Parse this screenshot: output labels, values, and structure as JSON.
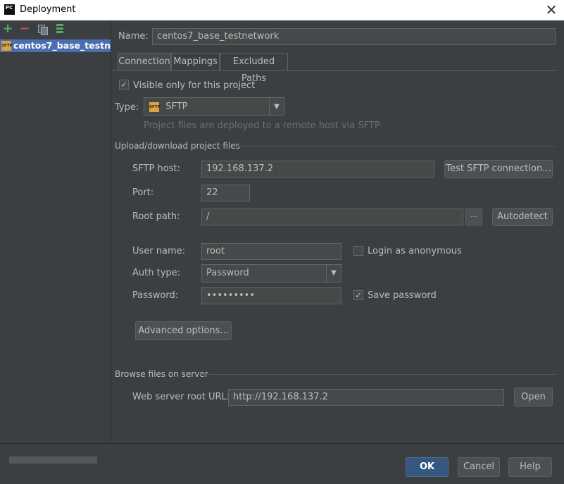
{
  "window": {
    "app_icon": "PC",
    "title": "Deployment",
    "close_icon": "close-icon"
  },
  "toolbar": {
    "add": "+",
    "remove": "−"
  },
  "servers": [
    {
      "name": "centos7_base_testnetwork",
      "icon_text": "SFTP"
    }
  ],
  "name_row": {
    "label": "Name:",
    "value": "centos7_base_testnetwork"
  },
  "tabs": [
    {
      "label": "Connection",
      "selected": true
    },
    {
      "label": "Mappings"
    },
    {
      "label": "Excluded Paths"
    }
  ],
  "connection": {
    "visible_only": {
      "label": "Visible only for this project",
      "checked": true
    },
    "type": {
      "label": "Type:",
      "value": "SFTP",
      "icon_text": "SFTP",
      "hint": "Project files are deployed to a remote host via SFTP"
    },
    "upload_section": "Upload/download project files",
    "sftp_host": {
      "label": "SFTP host:",
      "value": "192.168.137.2"
    },
    "test_button": "Test SFTP connection...",
    "port": {
      "label": "Port:",
      "value": "22"
    },
    "root_path": {
      "label": "Root path:",
      "value": "/"
    },
    "browse_button": "...",
    "autodetect_button": "Autodetect",
    "user_name": {
      "label": "User name:",
      "value": "root"
    },
    "login_anon": {
      "label": "Login as anonymous",
      "checked": false
    },
    "auth_type": {
      "label": "Auth type:",
      "value": "Password"
    },
    "password": {
      "label": "Password:",
      "value": "•••••••••"
    },
    "save_password": {
      "label": "Save password",
      "checked": true
    },
    "advanced_button": "Advanced options...",
    "browse_section": "Browse files on server",
    "web_root": {
      "label": "Web server root URL:",
      "value": "http://192.168.137.2"
    },
    "open_button": "Open"
  },
  "footer": {
    "ok": "OK",
    "cancel": "Cancel",
    "help": "Help"
  },
  "colors": {
    "background": "#3c3f41",
    "selection": "#4b6eaf",
    "ok_button": "#365880",
    "add_icon": "#59a869",
    "remove_icon": "#c75450",
    "sftp_icon": "#d9a343"
  }
}
